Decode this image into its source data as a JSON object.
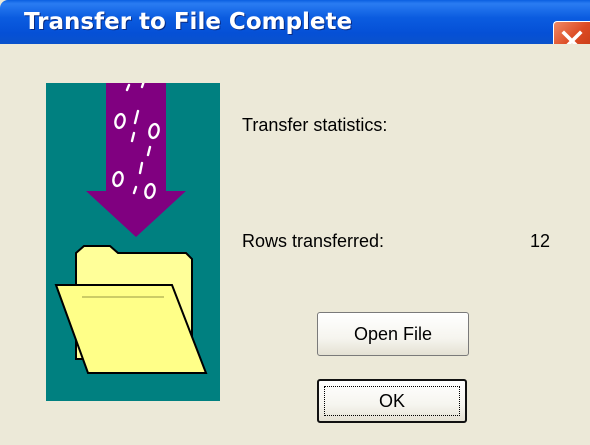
{
  "window": {
    "title": "Transfer to File Complete"
  },
  "dialog": {
    "stats_heading": "Transfer statistics:",
    "rows_label": "Rows transferred:",
    "rows_value": "12",
    "open_file_label": "Open File",
    "ok_label": "OK"
  },
  "icons": {
    "close": "close-icon",
    "illustration": "file-transfer-illustration"
  },
  "colors": {
    "titlebar": "#0b5ce0",
    "close_button": "#dc4a23",
    "dialog_background": "#ece9d8",
    "illustration_background": "#008080",
    "arrow": "#800080",
    "folder": "#ffff99"
  }
}
